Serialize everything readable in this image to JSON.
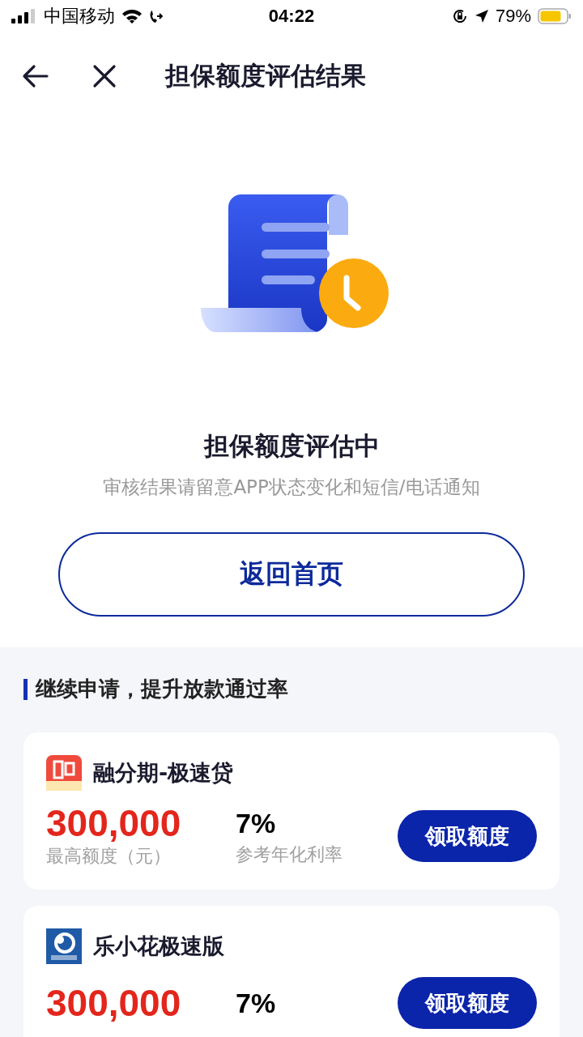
{
  "status_bar": {
    "carrier": "中国移动",
    "time": "04:22",
    "battery_percent": "79%"
  },
  "nav": {
    "title": "担保额度评估结果"
  },
  "result": {
    "title": "担保额度评估中",
    "subtitle": "审核结果请留意APP状态变化和短信/电话通知",
    "button": "返回首页"
  },
  "section": {
    "title": "继续申请，提升放款通过率"
  },
  "products": [
    {
      "kind": "red",
      "name": "融分期-极速贷",
      "amount": "300,000",
      "amount_label": "最高额度（元）",
      "rate": "7%",
      "rate_label": "参考年化利率",
      "button": "领取额度"
    },
    {
      "kind": "blue",
      "name": "乐小花极速版",
      "amount": "300,000",
      "rate": "7%",
      "button": "领取额度"
    }
  ]
}
